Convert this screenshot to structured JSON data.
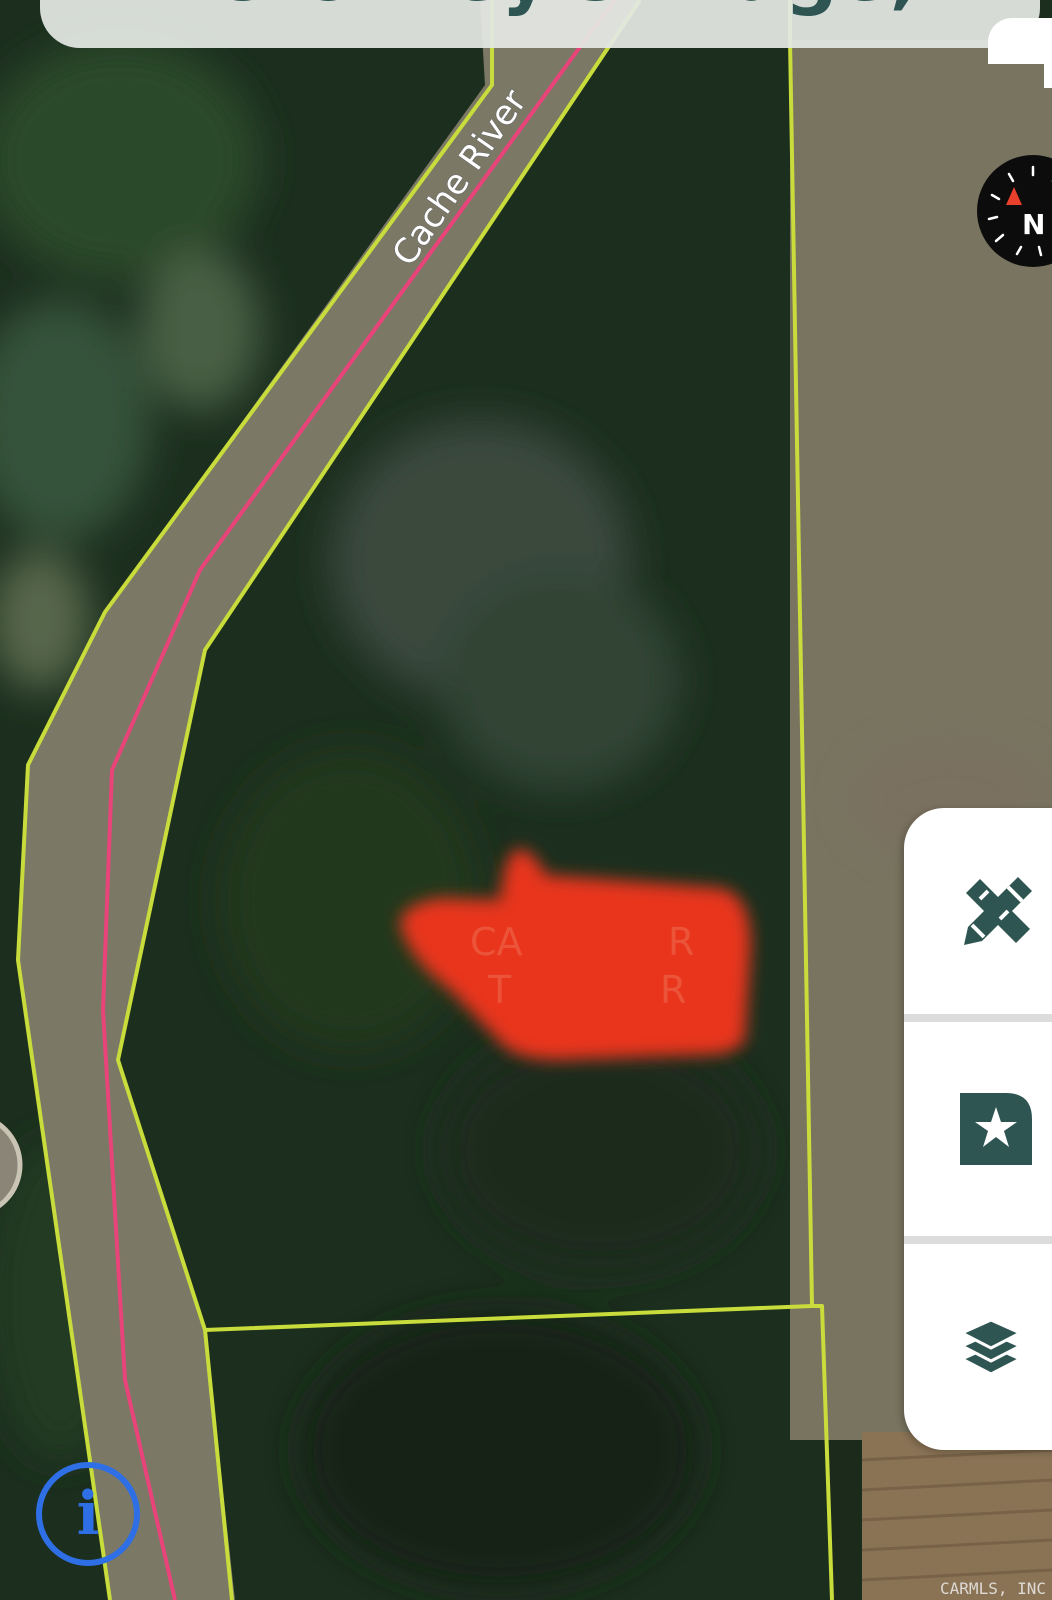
{
  "header": {
    "title": "Crowley's Ridge,..."
  },
  "map": {
    "layer": "satellite",
    "road_label": "Cache River",
    "parcel_line_color": "#c8dc3c",
    "route_line_color": "#e8447a",
    "marker_color": "#e8351f",
    "marker_label_line1": "CA",
    "marker_label_line1b": "R",
    "marker_label_line2": "T",
    "marker_label_line2b": "R",
    "copyright": "CARMLS, INC"
  },
  "compass": {
    "label": "N",
    "icon": "compass-icon"
  },
  "toolbar": {
    "items": [
      {
        "icon": "ruler-pencil-icon",
        "action": "measure-draw"
      },
      {
        "icon": "bookmark-star-icon",
        "action": "saved-places"
      },
      {
        "icon": "layers-icon",
        "action": "map-layers"
      }
    ]
  },
  "info": {
    "icon": "info-icon",
    "glyph": "i"
  }
}
